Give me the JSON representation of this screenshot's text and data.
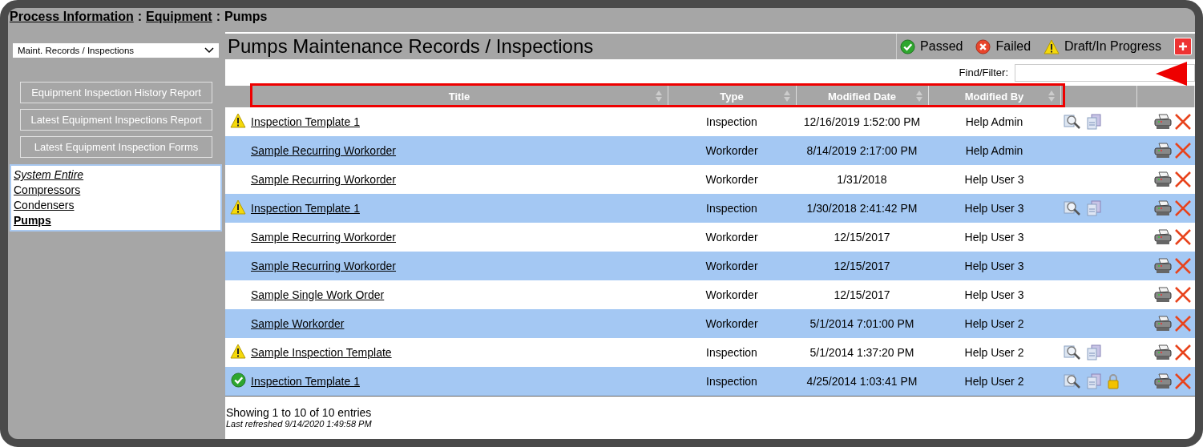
{
  "breadcrumb": [
    {
      "label": "Process Information",
      "kind": "link"
    },
    {
      "label": ":",
      "kind": "separator"
    },
    {
      "label": "Equipment",
      "kind": "link"
    },
    {
      "label": ":",
      "kind": "separator"
    },
    {
      "label": "Pumps",
      "kind": "current"
    }
  ],
  "sidebar": {
    "view_select": {
      "value": "Maint. Records / Inspections"
    },
    "buttons": [
      "Equipment Inspection History Report",
      "Latest Equipment Inspections Report",
      "Latest Equipment Inspection Forms"
    ],
    "tree": [
      {
        "label": "System Entire",
        "kind": "root",
        "selected": false
      },
      {
        "label": "Compressors",
        "kind": "item",
        "selected": false
      },
      {
        "label": "Condensers",
        "kind": "item",
        "selected": false
      },
      {
        "label": "Pumps",
        "kind": "item",
        "selected": true
      }
    ]
  },
  "main": {
    "title": "Pumps Maintenance Records / Inspections",
    "legend": [
      {
        "kind": "passed",
        "label": "Passed"
      },
      {
        "kind": "failed",
        "label": "Failed"
      },
      {
        "kind": "draft",
        "label": "Draft/In Progress"
      }
    ],
    "filter": {
      "label": "Find/Filter:"
    },
    "table": {
      "columns": [
        "Title",
        "Type",
        "Modified Date",
        "Modified By"
      ],
      "rows": [
        {
          "kind": "draft",
          "title": "Inspection Template 1",
          "type": "Inspection",
          "date": "12/16/2019 1:52:00 PM",
          "by": "Help Admin",
          "report_icons": true,
          "locked": false
        },
        {
          "kind": "none",
          "title": "Sample Recurring Workorder",
          "type": "Workorder",
          "date": "8/14/2019 2:17:00 PM",
          "by": "Help Admin",
          "report_icons": false,
          "locked": false
        },
        {
          "kind": "none",
          "title": "Sample Recurring Workorder",
          "type": "Workorder",
          "date": "1/31/2018",
          "by": "Help User 3",
          "report_icons": false,
          "locked": false
        },
        {
          "kind": "draft",
          "title": "Inspection Template 1",
          "type": "Inspection",
          "date": "1/30/2018 2:41:42 PM",
          "by": "Help User 3",
          "report_icons": true,
          "locked": false
        },
        {
          "kind": "none",
          "title": "Sample Recurring Workorder",
          "type": "Workorder",
          "date": "12/15/2017",
          "by": "Help User 3",
          "report_icons": false,
          "locked": false
        },
        {
          "kind": "none",
          "title": "Sample Recurring Workorder",
          "type": "Workorder",
          "date": "12/15/2017",
          "by": "Help User 3",
          "report_icons": false,
          "locked": false
        },
        {
          "kind": "none",
          "title": "Sample Single Work Order",
          "type": "Workorder",
          "date": "12/15/2017",
          "by": "Help User 3",
          "report_icons": false,
          "locked": false
        },
        {
          "kind": "none",
          "title": "Sample Workorder",
          "type": "Workorder",
          "date": "5/1/2014 7:01:00 PM",
          "by": "Help User 2",
          "report_icons": false,
          "locked": false
        },
        {
          "kind": "draft",
          "title": "Sample Inspection Template",
          "type": "Inspection",
          "date": "5/1/2014 1:37:20 PM",
          "by": "Help User 2",
          "report_icons": true,
          "locked": false
        },
        {
          "kind": "passed",
          "title": "Inspection Template 1",
          "type": "Inspection",
          "date": "4/25/2014 1:03:41 PM",
          "by": "Help User 2",
          "report_icons": true,
          "locked": true
        }
      ]
    },
    "info": "Showing 1 to 10 of 10 entries",
    "refreshed": "Last refreshed 9/14/2020 1:49:58 PM"
  }
}
